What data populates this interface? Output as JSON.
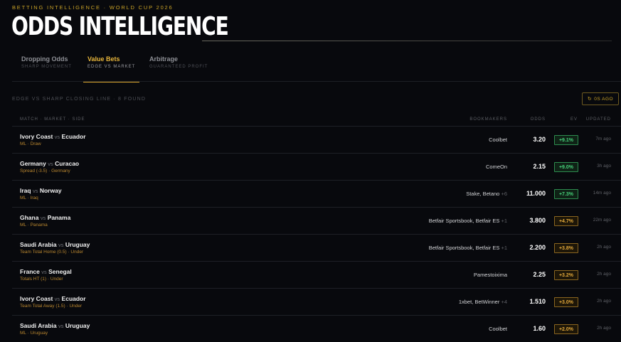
{
  "header": {
    "eyebrow": "BETTING INTELLIGENCE · WORLD CUP 2026",
    "title": "ODDS INTELLIGENCE"
  },
  "tabs": [
    {
      "label": "Dropping Odds",
      "sub": "SHARP MOVEMENT",
      "active": false
    },
    {
      "label": "Value Bets",
      "sub": "EDGE VS MARKET",
      "active": true
    },
    {
      "label": "Arbitrage",
      "sub": "GUARANTEED PROFIT",
      "active": false
    }
  ],
  "summary": "EDGE VS SHARP CLOSING LINE · 8 FOUND",
  "refresh": {
    "icon": "refresh-icon",
    "label": "0S AGO"
  },
  "columns": {
    "match": "MATCH · MARKET · SIDE",
    "bookmakers": "BOOKMAKERS",
    "odds": "ODDS",
    "ev": "EV",
    "updated": "UPDATED"
  },
  "colors": {
    "accent": "#e7b53b",
    "ev_high": "#46d07a",
    "ev_mid": "#e3a93b",
    "background": "#08090d"
  },
  "rows": [
    {
      "home": "Ivory Coast",
      "vs": "vs",
      "away": "Ecuador",
      "market": "ML · Draw",
      "books": "Coolbet",
      "more": "",
      "odds": "3.20",
      "ev": "+9.1%",
      "ev_level": "high",
      "updated": "7m ago"
    },
    {
      "home": "Germany",
      "vs": "vs",
      "away": "Curacao",
      "market": "Spread (-3.5) · Germany",
      "books": "ComeOn",
      "more": "",
      "odds": "2.15",
      "ev": "+9.0%",
      "ev_level": "high",
      "updated": "3h ago"
    },
    {
      "home": "Iraq",
      "vs": "vs",
      "away": "Norway",
      "market": "ML · Iraq",
      "books": "Stake, Betano",
      "more": "+6",
      "odds": "11.000",
      "ev": "+7.3%",
      "ev_level": "high",
      "updated": "14m ago"
    },
    {
      "home": "Ghana",
      "vs": "vs",
      "away": "Panama",
      "market": "ML · Panama",
      "books": "Betfair Sportsbook, Betfair ES",
      "more": "+1",
      "odds": "3.800",
      "ev": "+4.7%",
      "ev_level": "mid",
      "updated": "22m ago"
    },
    {
      "home": "Saudi Arabia",
      "vs": "vs",
      "away": "Uruguay",
      "market": "Team Total Home (0.5) · Under",
      "books": "Betfair Sportsbook, Betfair ES",
      "more": "+1",
      "odds": "2.200",
      "ev": "+3.8%",
      "ev_level": "mid",
      "updated": "2h ago"
    },
    {
      "home": "France",
      "vs": "vs",
      "away": "Senegal",
      "market": "Totals HT (1) · Under",
      "books": "Pamestoixima",
      "more": "",
      "odds": "2.25",
      "ev": "+3.2%",
      "ev_level": "mid",
      "updated": "2h ago"
    },
    {
      "home": "Ivory Coast",
      "vs": "vs",
      "away": "Ecuador",
      "market": "Team Total Away (1.5) · Under",
      "books": "1xbet, BetWinner",
      "more": "+4",
      "odds": "1.510",
      "ev": "+3.0%",
      "ev_level": "mid",
      "updated": "2h ago"
    },
    {
      "home": "Saudi Arabia",
      "vs": "vs",
      "away": "Uruguay",
      "market": "ML · Uruguay",
      "books": "Coolbet",
      "more": "",
      "odds": "1.60",
      "ev": "+2.0%",
      "ev_level": "mid",
      "updated": "2h ago"
    }
  ]
}
